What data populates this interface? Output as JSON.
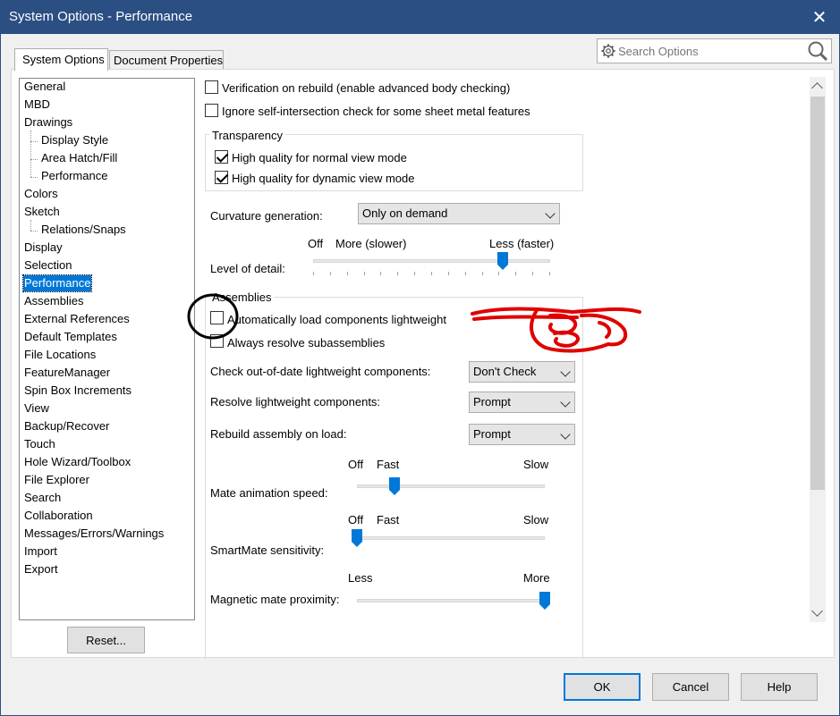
{
  "window": {
    "title": "System Options - Performance"
  },
  "search": {
    "placeholder": "Search Options"
  },
  "tabs": [
    {
      "label": "System Options",
      "active": true
    },
    {
      "label": "Document Properties",
      "active": false
    }
  ],
  "tree": [
    {
      "label": "General",
      "child": false
    },
    {
      "label": "MBD",
      "child": false
    },
    {
      "label": "Drawings",
      "child": false
    },
    {
      "label": "Display Style",
      "child": true
    },
    {
      "label": "Area Hatch/Fill",
      "child": true
    },
    {
      "label": "Performance",
      "child": true
    },
    {
      "label": "Colors",
      "child": false
    },
    {
      "label": "Sketch",
      "child": false
    },
    {
      "label": "Relations/Snaps",
      "child": true
    },
    {
      "label": "Display",
      "child": false
    },
    {
      "label": "Selection",
      "child": false
    },
    {
      "label": "Performance",
      "child": false,
      "selected": true
    },
    {
      "label": "Assemblies",
      "child": false
    },
    {
      "label": "External References",
      "child": false
    },
    {
      "label": "Default Templates",
      "child": false
    },
    {
      "label": "File Locations",
      "child": false
    },
    {
      "label": "FeatureManager",
      "child": false
    },
    {
      "label": "Spin Box Increments",
      "child": false
    },
    {
      "label": "View",
      "child": false
    },
    {
      "label": "Backup/Recover",
      "child": false
    },
    {
      "label": "Touch",
      "child": false
    },
    {
      "label": "Hole Wizard/Toolbox",
      "child": false
    },
    {
      "label": "File Explorer",
      "child": false
    },
    {
      "label": "Search",
      "child": false
    },
    {
      "label": "Collaboration",
      "child": false
    },
    {
      "label": "Messages/Errors/Warnings",
      "child": false
    },
    {
      "label": "Import",
      "child": false
    },
    {
      "label": "Export",
      "child": false
    }
  ],
  "reset_label": "Reset...",
  "options": {
    "verification": {
      "label": "Verification on rebuild (enable advanced body checking)",
      "checked": false
    },
    "ignore_self": {
      "label": "Ignore self-intersection check for some sheet metal features",
      "checked": false
    },
    "transparency": {
      "title": "Transparency",
      "normal": {
        "label": "High quality for normal view mode",
        "checked": true
      },
      "dynamic": {
        "label": "High quality for dynamic view mode",
        "checked": true
      }
    },
    "curvature": {
      "label": "Curvature generation:",
      "value": "Only on demand"
    },
    "lod": {
      "label": "Level of detail:",
      "off": "Off",
      "left": "More (slower)",
      "right": "Less (faster)",
      "position": 0.8
    },
    "assemblies": {
      "title": "Assemblies",
      "auto_load": {
        "label": "Automatically load components lightweight",
        "checked": false
      },
      "always_resolve": {
        "label": "Always resolve subassemblies",
        "checked": false
      },
      "check_outdated": {
        "label": "Check out-of-date lightweight components:",
        "value": "Don't Check"
      },
      "resolve_lw": {
        "label": "Resolve lightweight components:",
        "value": "Prompt"
      },
      "rebuild": {
        "label": "Rebuild assembly on load:",
        "value": "Prompt"
      }
    },
    "mate_anim": {
      "label": "Mate animation speed:",
      "off": "Off",
      "left": "Fast",
      "right": "Slow",
      "position": 0.2
    },
    "smartmate": {
      "label": "SmartMate sensitivity:",
      "off": "Off",
      "left": "Fast",
      "right": "Slow",
      "position": 0.0
    },
    "magnetic": {
      "label": "Magnetic mate proximity:",
      "left": "Less",
      "right": "More",
      "position": 1.0
    }
  },
  "buttons": {
    "ok": "OK",
    "cancel": "Cancel",
    "help": "Help"
  },
  "colors": {
    "titlebar": "#2b4f82",
    "accent": "#0078d7",
    "annotation_red": "#e00000"
  }
}
